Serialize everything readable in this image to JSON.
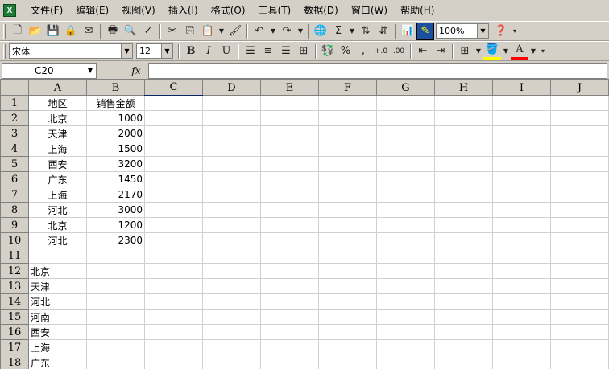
{
  "menubar": {
    "items": [
      "文件(F)",
      "编辑(E)",
      "视图(V)",
      "插入(I)",
      "格式(O)",
      "工具(T)",
      "数据(D)",
      "窗口(W)",
      "帮助(H)"
    ]
  },
  "toolbar": {
    "zoom": "100%",
    "sigma": "Σ",
    "percent": "%",
    "comma": ",",
    "inc_decimal": "+.0",
    "dec_decimal": ".00"
  },
  "format_toolbar": {
    "font_name": "宋体",
    "font_size": "12",
    "bold": "B",
    "italic": "I",
    "underline": "U",
    "font_color_letter": "A"
  },
  "formula_bar": {
    "name_box": "C20",
    "fx": "fx",
    "value": ""
  },
  "sheet": {
    "columns": [
      "A",
      "B",
      "C",
      "D",
      "E",
      "F",
      "G",
      "H",
      "I",
      "J"
    ],
    "rows": [
      {
        "n": "1",
        "a": "地区",
        "b": "销售金额"
      },
      {
        "n": "2",
        "a": "北京",
        "b": "1000"
      },
      {
        "n": "3",
        "a": "天津",
        "b": "2000"
      },
      {
        "n": "4",
        "a": "上海",
        "b": "1500"
      },
      {
        "n": "5",
        "a": "西安",
        "b": "3200"
      },
      {
        "n": "6",
        "a": "广东",
        "b": "1450"
      },
      {
        "n": "7",
        "a": "上海",
        "b": "2170"
      },
      {
        "n": "8",
        "a": "河北",
        "b": "3000"
      },
      {
        "n": "9",
        "a": "北京",
        "b": "1200"
      },
      {
        "n": "10",
        "a": "河北",
        "b": "2300"
      },
      {
        "n": "11",
        "a": "",
        "b": ""
      },
      {
        "n": "12",
        "a": "北京",
        "b": ""
      },
      {
        "n": "13",
        "a": "天津",
        "b": ""
      },
      {
        "n": "14",
        "a": "河北",
        "b": ""
      },
      {
        "n": "15",
        "a": "河南",
        "b": ""
      },
      {
        "n": "16",
        "a": "西安",
        "b": ""
      },
      {
        "n": "17",
        "a": "上海",
        "b": ""
      },
      {
        "n": "18",
        "a": "广东",
        "b": ""
      }
    ]
  }
}
